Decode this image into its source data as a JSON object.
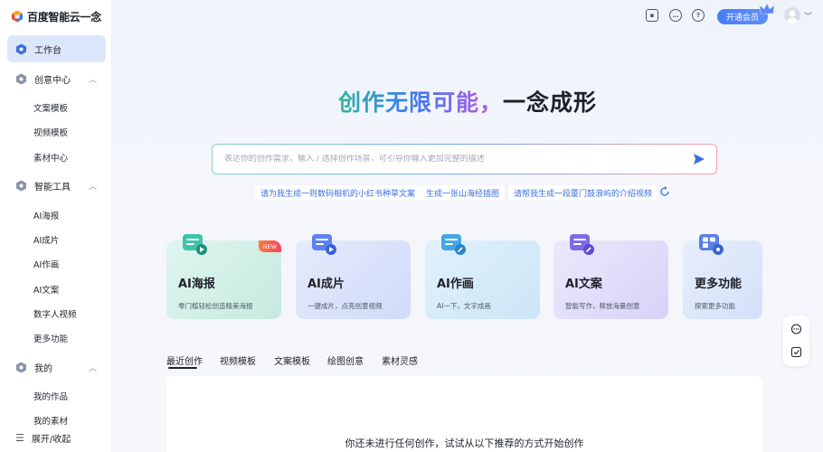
{
  "app": {
    "logo_text": "百度智能云一念"
  },
  "sidebar": {
    "active_item": {
      "label": "工作台",
      "icon": "workbench-icon"
    },
    "groups": [
      {
        "label": "创意中心",
        "icon": "creative-center-icon",
        "expanded": true,
        "items": [
          "文案模板",
          "视频模板",
          "素材中心"
        ]
      },
      {
        "label": "智能工具",
        "icon": "smart-tools-icon",
        "expanded": true,
        "items": [
          "AI海报",
          "AI成片",
          "AI作画",
          "AI文案",
          "数字人视频",
          "更多功能"
        ]
      },
      {
        "label": "我的",
        "icon": "mine-icon",
        "expanded": true,
        "items": [
          "我的作品",
          "我的素材"
        ]
      }
    ],
    "collapse_label": "展开/收起"
  },
  "header": {
    "icons": [
      "screen-icon",
      "message-icon",
      "help-icon"
    ],
    "vip_label": "开通会员",
    "avatar": "avatar-icon"
  },
  "hero": {
    "title_gradient": "创作无限可能，",
    "title_dark": "一念成形"
  },
  "search": {
    "placeholder": "表达你的创作需求，输入 / 选择创作场景，可引导你输入更加完整的描述"
  },
  "suggestions": [
    "请为我生成一则数码相机的小红书种草文案",
    "生成一张山海经插图",
    "请帮我生成一段厦门鼓浪屿的介绍视频"
  ],
  "cards": [
    {
      "title": "AI海报",
      "subtitle": "零门槛轻松创造精美海报",
      "badge": "NEW",
      "icon": "poster-icon",
      "color_from": "#dff5ee",
      "color_to": "#c9ece4"
    },
    {
      "title": "AI成片",
      "subtitle": "一键成片，点亮创意视频",
      "badge": "",
      "icon": "video-icon",
      "color_from": "#e3e9fb",
      "color_to": "#d3ddf8"
    },
    {
      "title": "AI作画",
      "subtitle": "AI一下，文字成画",
      "badge": "",
      "icon": "painting-icon",
      "color_from": "#e1f0fb",
      "color_to": "#cfe6f8"
    },
    {
      "title": "AI文案",
      "subtitle": "智能写作，释放海量创意",
      "badge": "",
      "icon": "copywriting-icon",
      "color_from": "#e8e6fb",
      "color_to": "#dad7f8"
    },
    {
      "title": "更多功能",
      "subtitle": "探索更多功能",
      "badge": "",
      "icon": "more-features-icon",
      "color_from": "#e6edfb",
      "color_to": "#d8e3f9"
    }
  ],
  "tabs": [
    "最近创作",
    "视频模板",
    "文案模板",
    "绘图创意",
    "素材灵感"
  ],
  "empty_state": "你还未进行任何创作，试试从以下推荐的方式开始创作",
  "float_tools": [
    "feedback-icon",
    "checklist-icon"
  ]
}
